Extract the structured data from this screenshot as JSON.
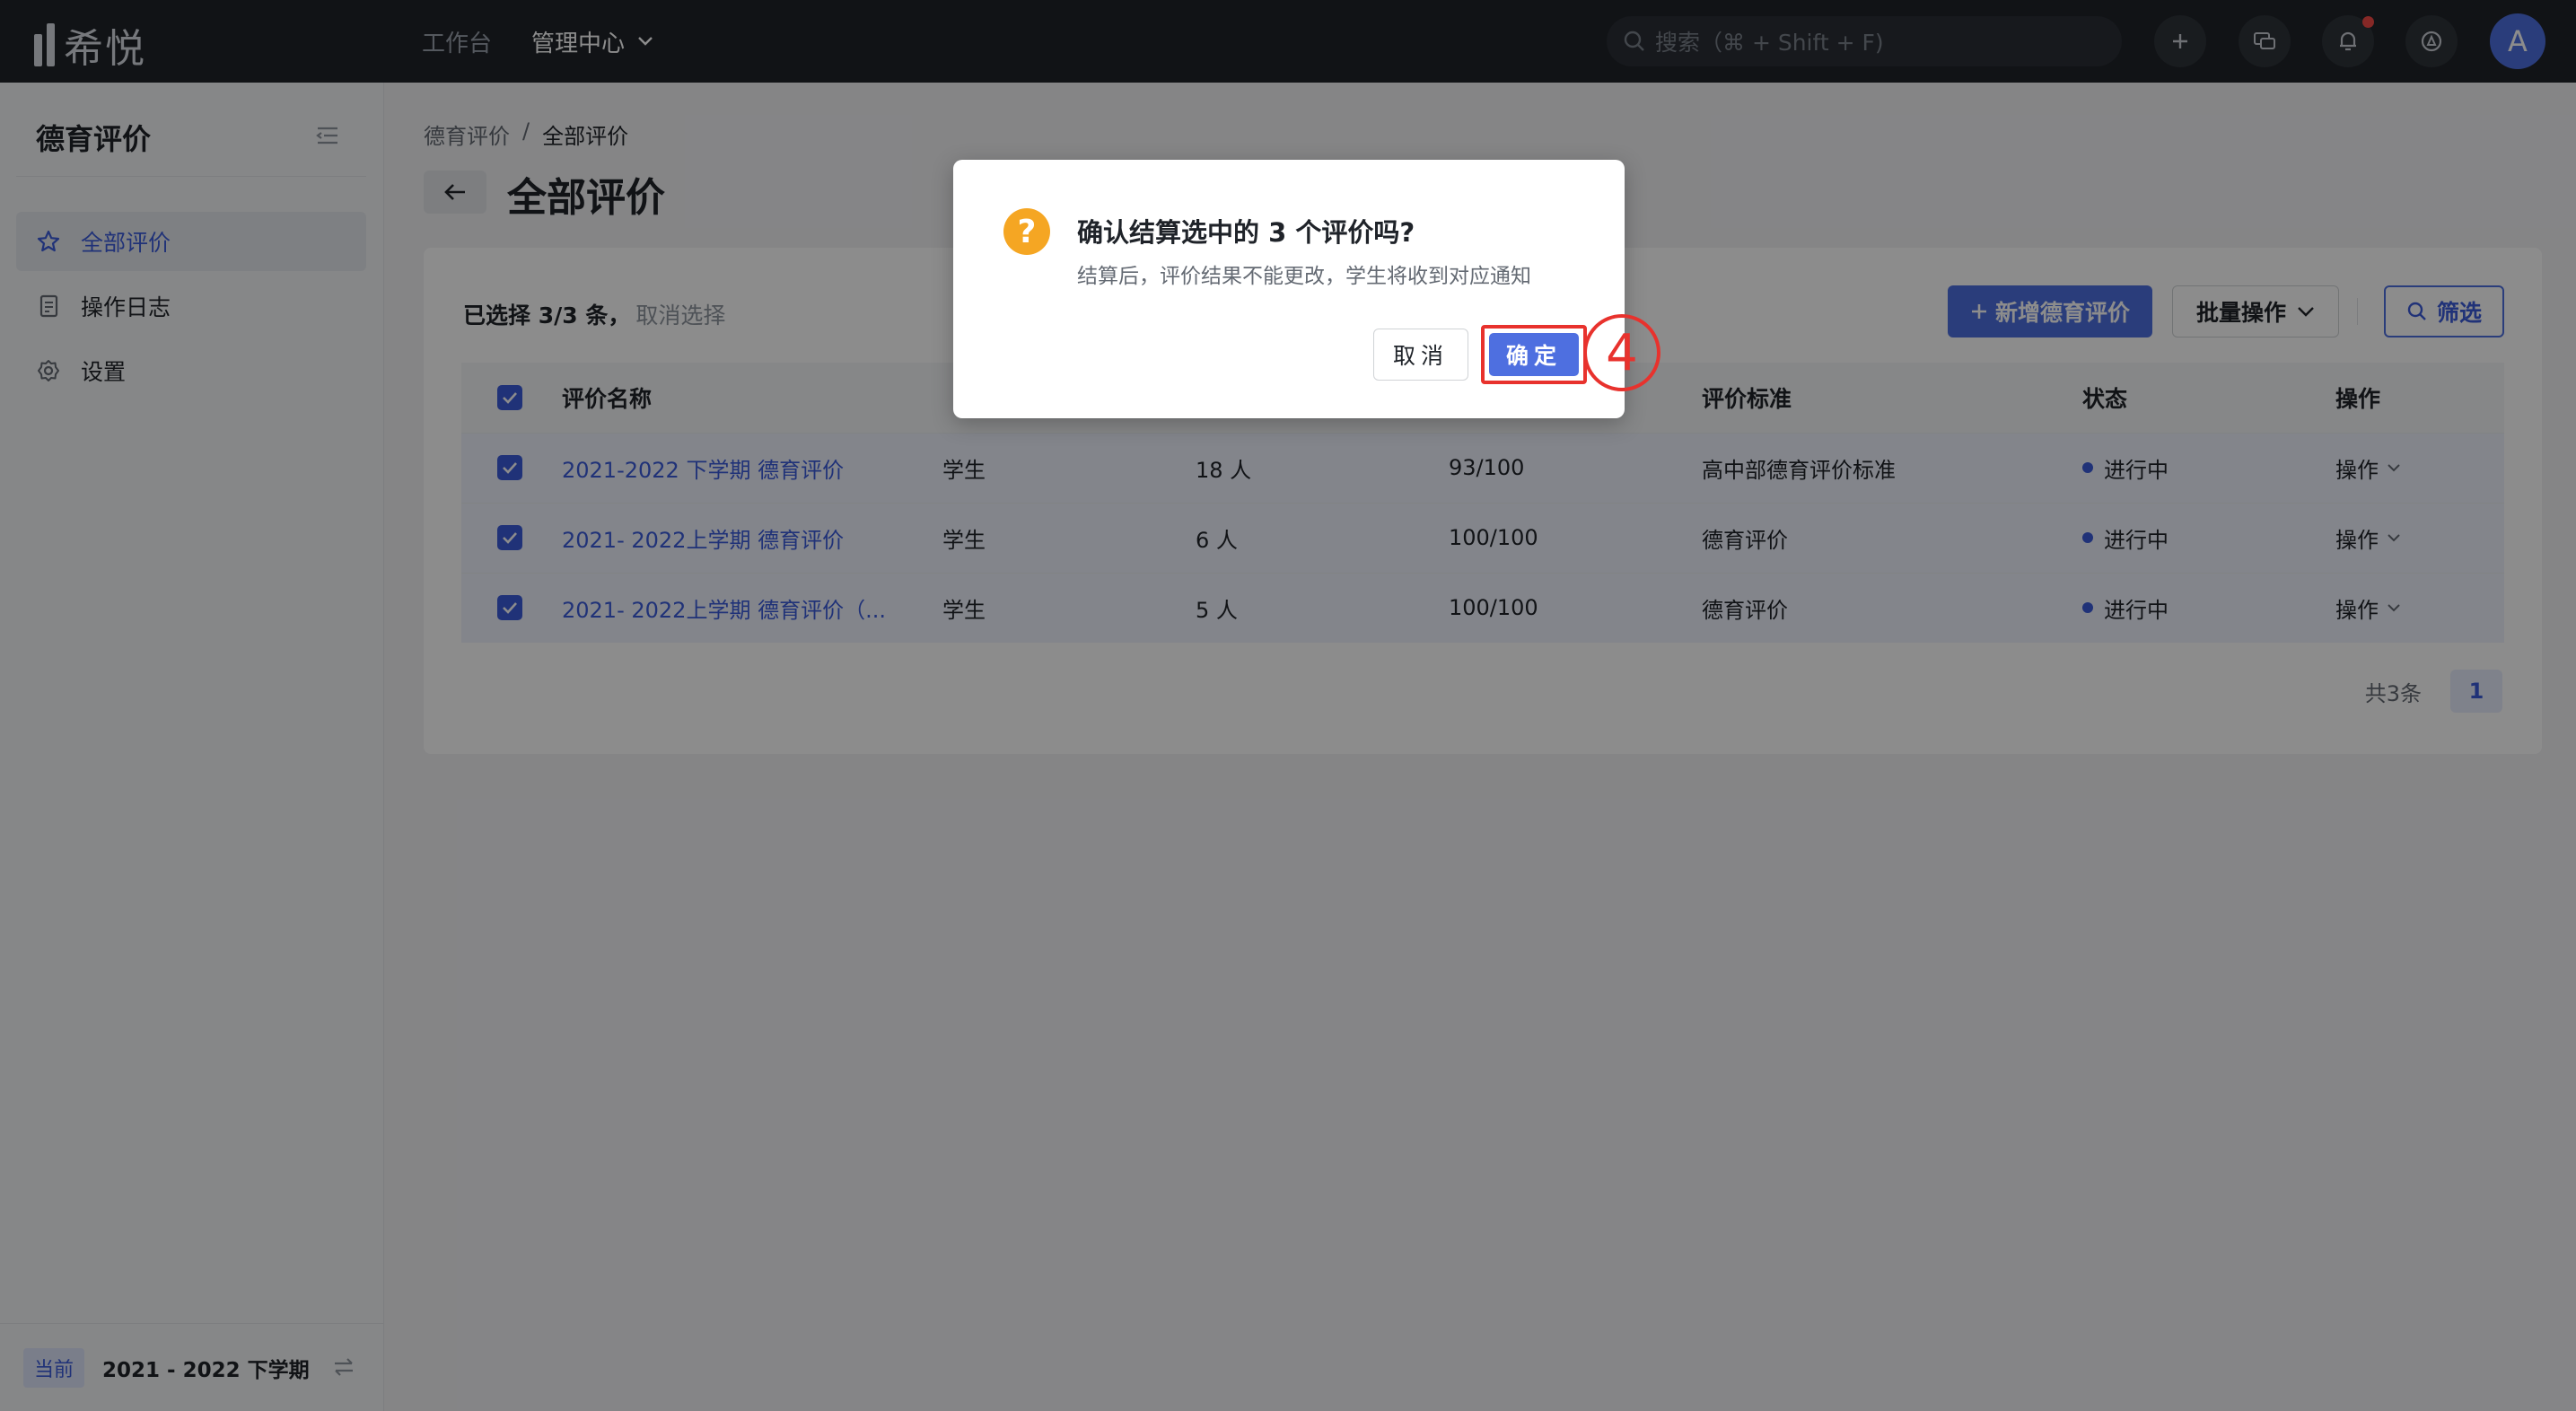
{
  "app": {
    "logo_text": "希悦"
  },
  "topnav": {
    "workbench": "工作台",
    "admin_center": "管理中心"
  },
  "search": {
    "placeholder": "搜索（⌘ + Shift + F)"
  },
  "avatar": {
    "initial": "A"
  },
  "sidebar": {
    "title": "德育评价",
    "items": [
      {
        "label": "全部评价",
        "icon": "star-icon",
        "active": true
      },
      {
        "label": "操作日志",
        "icon": "document-icon",
        "active": false
      },
      {
        "label": "设置",
        "icon": "gear-icon",
        "active": false
      }
    ],
    "footer": {
      "tag": "当前",
      "term": "2021 - 2022 下学期"
    }
  },
  "breadcrumb": {
    "parent": "德育评价",
    "separator": "/",
    "current": "全部评价"
  },
  "page": {
    "title": "全部评价"
  },
  "toolbar": {
    "selected_prefix": "已选择 3/3 条，",
    "clear_selection": "取消选择",
    "add_button": "新增德育评价",
    "batch_button": "批量操作",
    "filter_button": "筛选"
  },
  "table": {
    "headers": [
      "评价名称",
      "",
      "",
      "",
      "评价标准",
      "状态",
      "操作"
    ],
    "rows": [
      {
        "name": "2021-2022 下学期 德育评价",
        "target": "学生",
        "count": "18 人",
        "progress": "93/100",
        "standard": "高中部德育评价标准",
        "status": "进行中",
        "action": "操作"
      },
      {
        "name": "2021- 2022上学期 德育评价",
        "target": "学生",
        "count": "6 人",
        "progress": "100/100",
        "standard": "德育评价",
        "status": "进行中",
        "action": "操作"
      },
      {
        "name": "2021- 2022上学期 德育评价（...",
        "target": "学生",
        "count": "5 人",
        "progress": "100/100",
        "standard": "德育评价",
        "status": "进行中",
        "action": "操作"
      }
    ]
  },
  "pager": {
    "total": "共3条",
    "current_page": "1"
  },
  "modal": {
    "title": "确认结算选中的 3 个评价吗?",
    "description": "结算后，评价结果不能更改，学生将收到对应通知",
    "cancel": "取消",
    "confirm": "确定",
    "step_marker": "4"
  },
  "colors": {
    "primary": "#4e6fe0",
    "highlight": "#e8322d",
    "warning": "#f5a623"
  }
}
